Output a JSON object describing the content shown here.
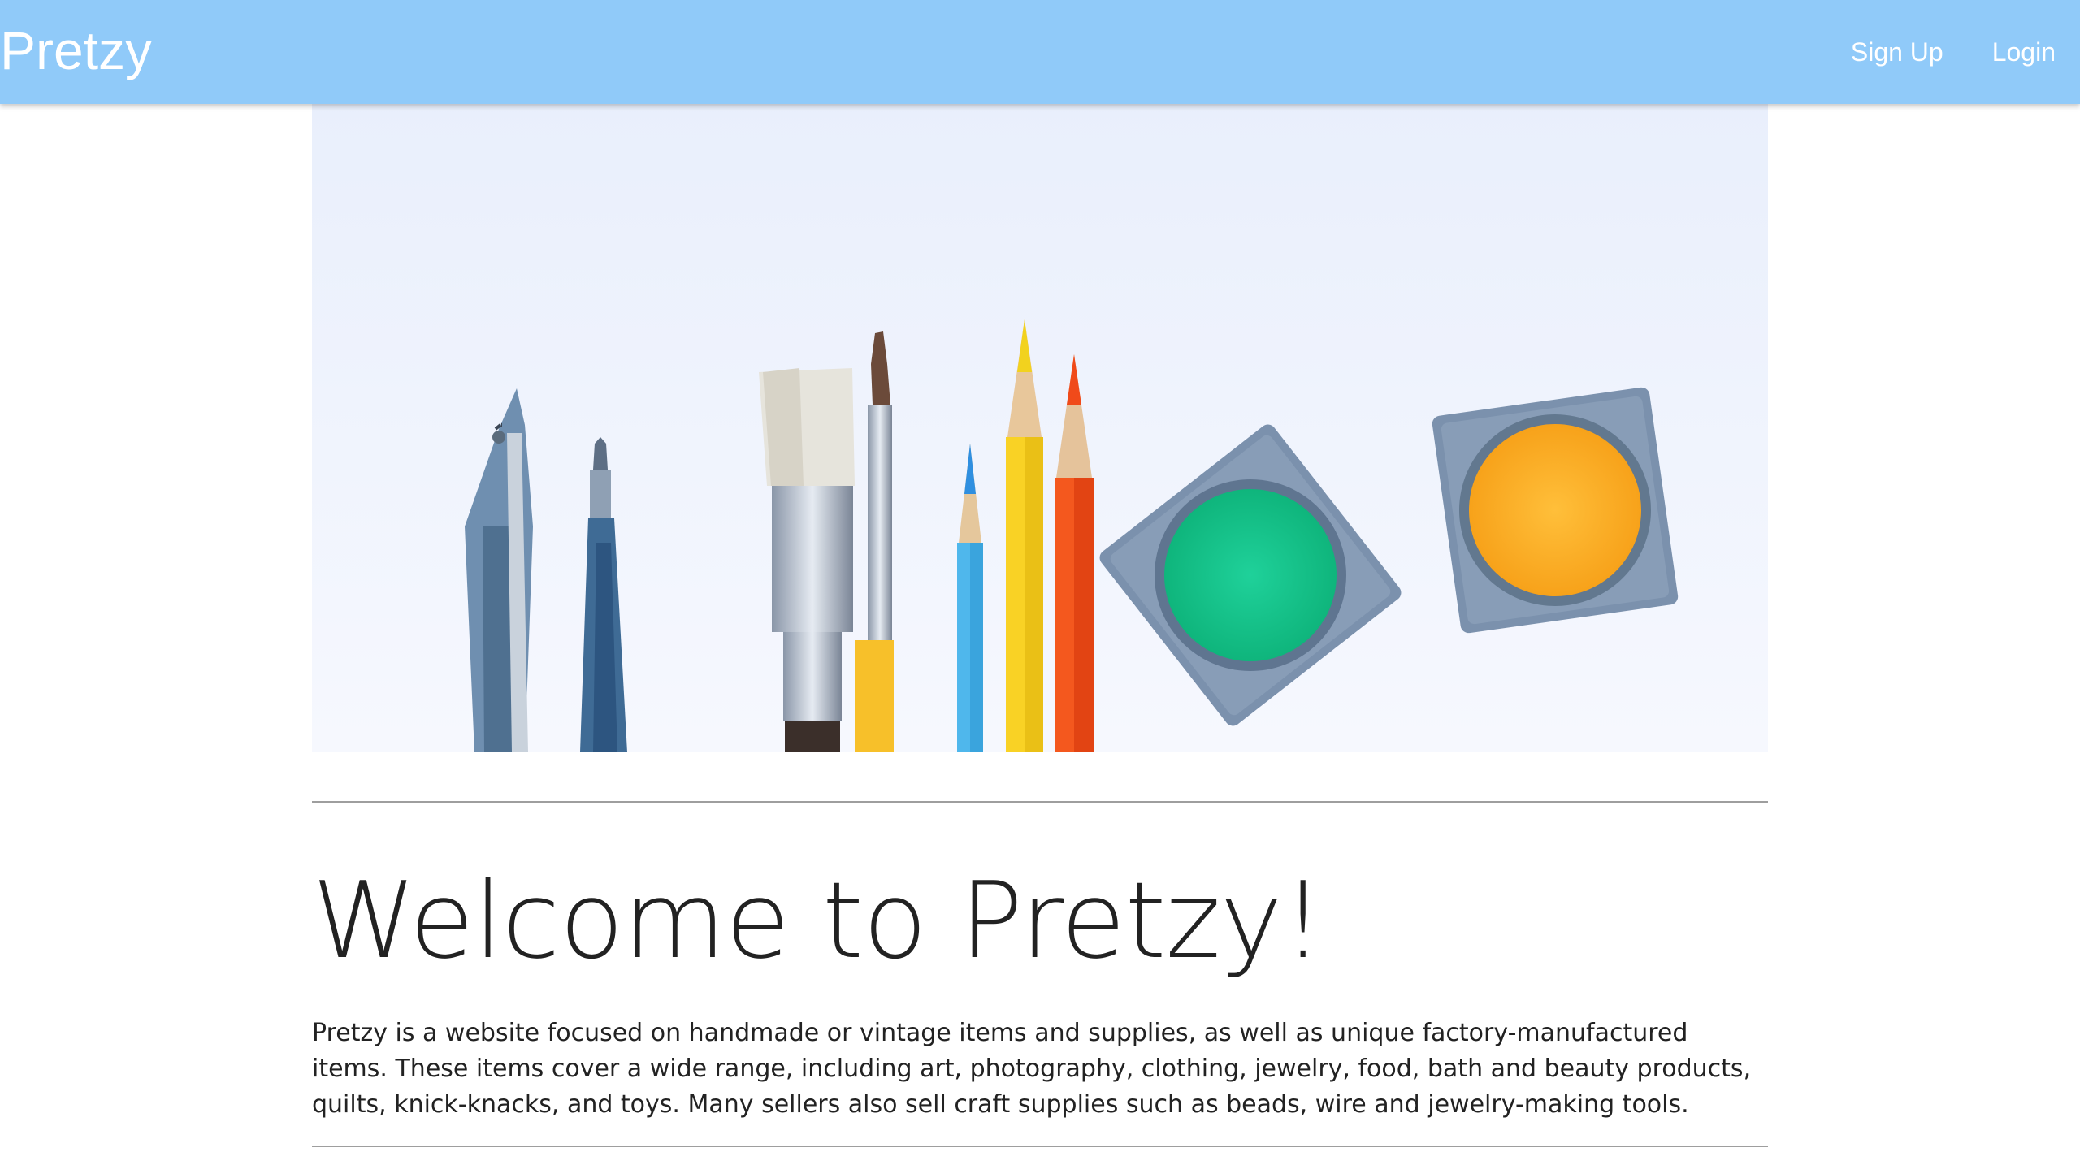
{
  "navbar": {
    "brand": "Pretzy",
    "links": [
      {
        "label": "Sign Up"
      },
      {
        "label": "Login"
      }
    ],
    "color": "#90caf9"
  },
  "hero": {
    "alt": "Art supplies: compass, pens, brushes, colored pencils and paint pots"
  },
  "main": {
    "title": "Welcome to Pretzy!",
    "description": "Pretzy is a website focused on handmade or vintage items and supplies, as well as unique factory-manufactured items. These items cover a wide range, including art, photography, clothing, jewelry, food, bath and beauty products, quilts, knick-knacks, and toys. Many sellers also sell craft supplies such as beads, wire and jewelry-making tools."
  }
}
